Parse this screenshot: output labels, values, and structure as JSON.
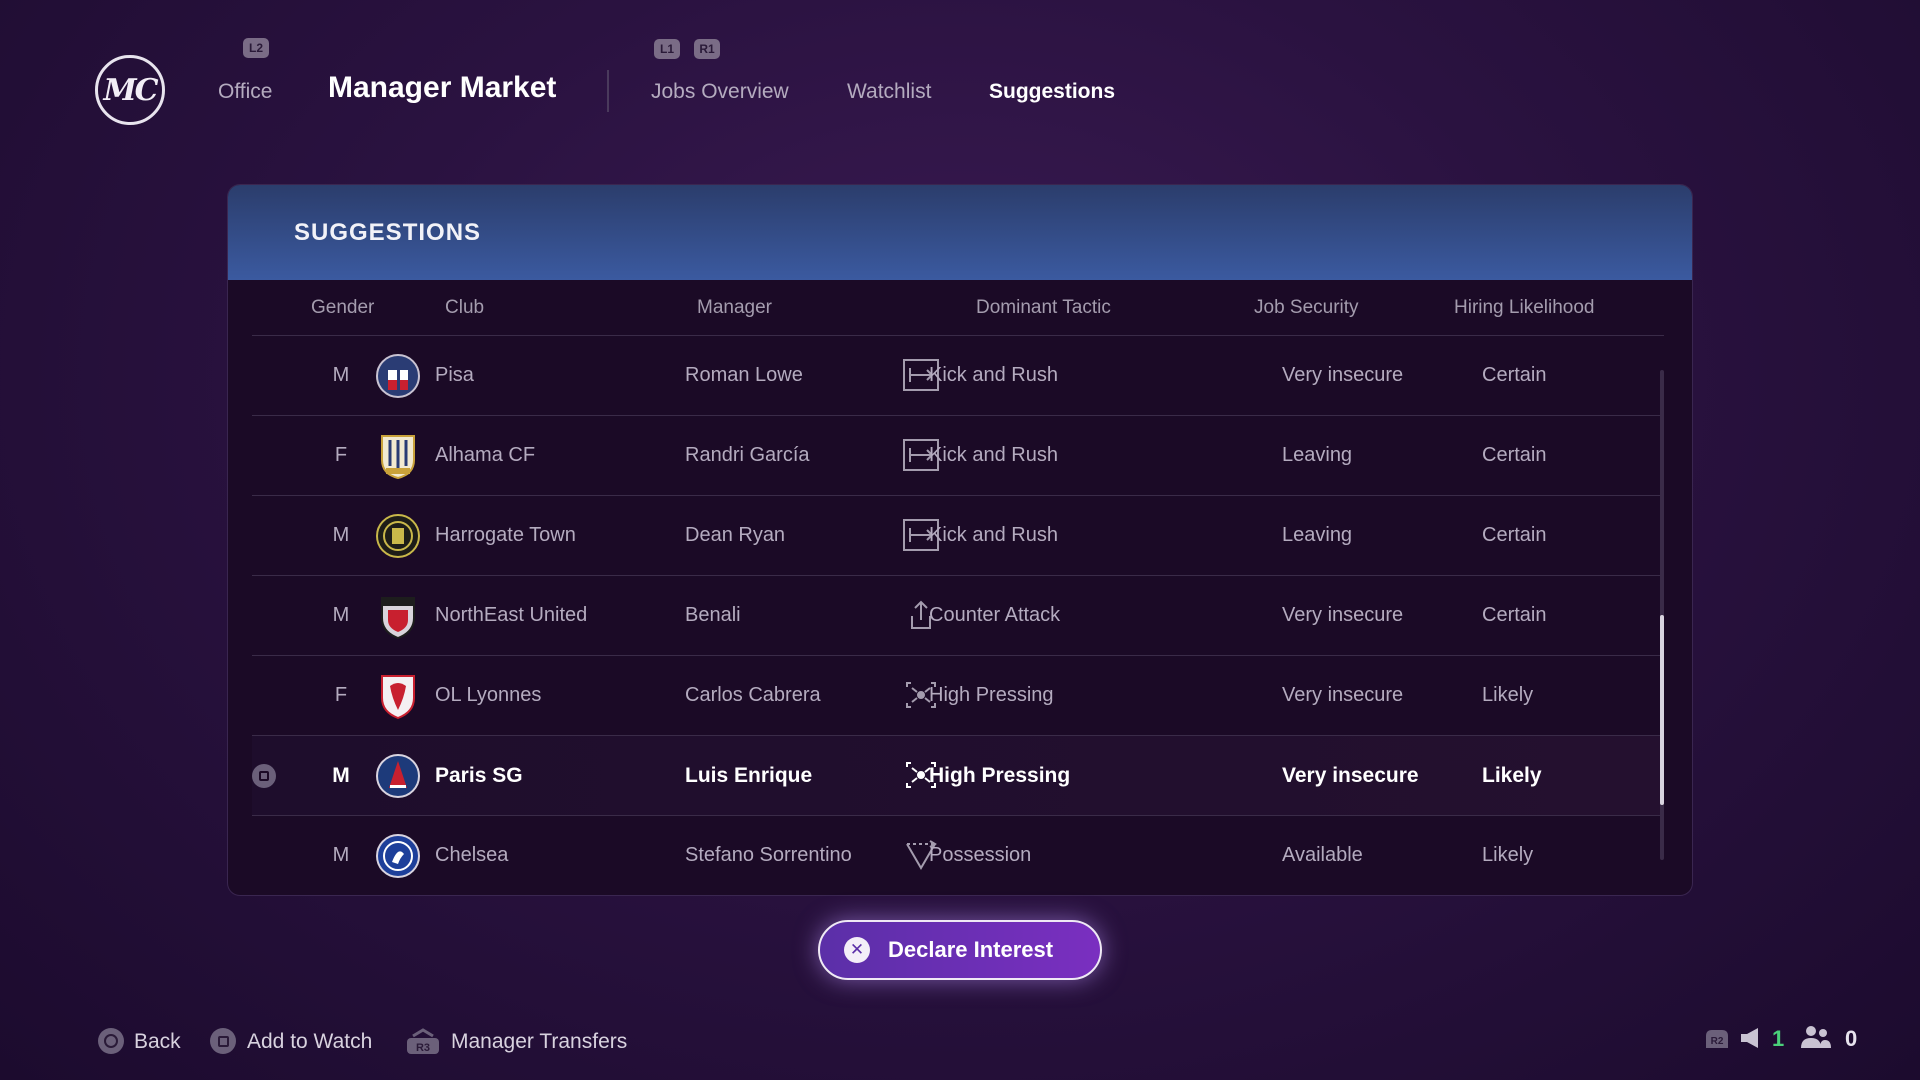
{
  "nav": {
    "logo_text": "MC",
    "l2_hint": "L2",
    "office_label": "Office",
    "title": "Manager Market",
    "l1_hint": "L1",
    "r1_hint": "R1",
    "tabs": [
      {
        "label": "Jobs Overview",
        "active": false
      },
      {
        "label": "Watchlist",
        "active": false
      },
      {
        "label": "Suggestions",
        "active": true
      }
    ]
  },
  "panel": {
    "title": "SUGGESTIONS",
    "columns": {
      "gender": "Gender",
      "club": "Club",
      "manager": "Manager",
      "tactic": "Dominant Tactic",
      "security": "Job Security",
      "hiring": "Hiring Likelihood"
    },
    "rows": [
      {
        "gender": "M",
        "club": "Pisa",
        "manager": "Roman Lowe",
        "tactic": "Kick and Rush",
        "tactic_icon": "kick-and-rush-icon",
        "security": "Very insecure",
        "hiring": "Certain",
        "crest_icon": "pisa-crest-icon",
        "selected": false
      },
      {
        "gender": "F",
        "club": "Alhama CF",
        "manager": "Randri García",
        "tactic": "Kick and Rush",
        "tactic_icon": "kick-and-rush-icon",
        "security": "Leaving",
        "hiring": "Certain",
        "crest_icon": "alhama-crest-icon",
        "selected": false
      },
      {
        "gender": "M",
        "club": "Harrogate Town",
        "manager": "Dean Ryan",
        "tactic": "Kick and Rush",
        "tactic_icon": "kick-and-rush-icon",
        "security": "Leaving",
        "hiring": "Certain",
        "crest_icon": "harrogate-crest-icon",
        "selected": false
      },
      {
        "gender": "M",
        "club": "NorthEast United",
        "manager": "Benali",
        "tactic": "Counter Attack",
        "tactic_icon": "counter-attack-icon",
        "security": "Very insecure",
        "hiring": "Certain",
        "crest_icon": "northeast-united-crest-icon",
        "selected": false
      },
      {
        "gender": "F",
        "club": "OL Lyonnes",
        "manager": "Carlos Cabrera",
        "tactic": "High Pressing",
        "tactic_icon": "high-pressing-icon",
        "security": "Very insecure",
        "hiring": "Likely",
        "crest_icon": "ol-lyonnes-crest-icon",
        "selected": false
      },
      {
        "gender": "M",
        "club": "Paris SG",
        "manager": "Luis Enrique",
        "tactic": "High Pressing",
        "tactic_icon": "high-pressing-icon",
        "security": "Very insecure",
        "hiring": "Likely",
        "crest_icon": "paris-sg-crest-icon",
        "selected": true
      },
      {
        "gender": "M",
        "club": "Chelsea",
        "manager": "Stefano Sorrentino",
        "tactic": "Possession",
        "tactic_icon": "possession-icon",
        "security": "Available",
        "hiring": "Likely",
        "crest_icon": "chelsea-crest-icon",
        "selected": false
      }
    ]
  },
  "declare": {
    "label": "Declare Interest"
  },
  "footer": {
    "back": "Back",
    "add_to_watch": "Add to Watch",
    "manager_transfers": "Manager Transfers",
    "r3_hint": "R3",
    "r2_hint": "R2",
    "count_left": "1",
    "count_right": "0"
  },
  "colors": {
    "accent": "#7a2fc0",
    "header_blue": "#3b5aa0",
    "count_green": "#4ad07a"
  }
}
